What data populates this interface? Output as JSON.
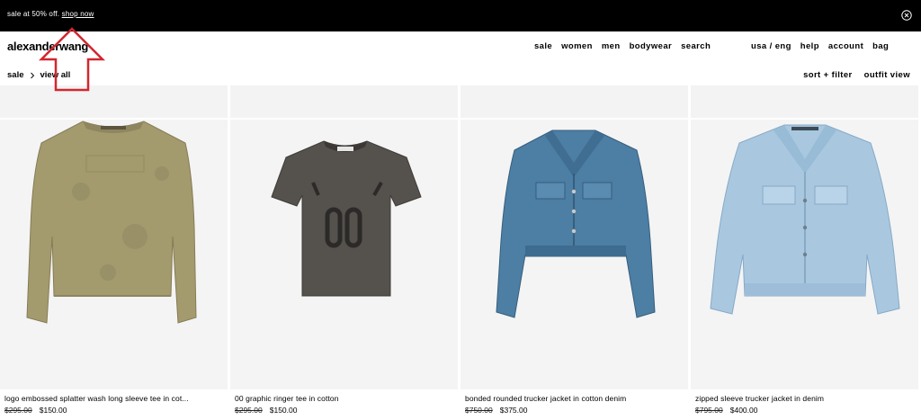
{
  "promo": {
    "text": "sale at 50% off.",
    "link": "shop now"
  },
  "logo": "alexanderwang",
  "nav": [
    "sale",
    "women",
    "men",
    "bodywear",
    "search"
  ],
  "utility": [
    "usa / eng",
    "help",
    "account",
    "bag"
  ],
  "breadcrumb": {
    "parent": "sale",
    "current": "view all"
  },
  "tools": {
    "sort_filter": "sort + filter",
    "outfit_view": "outfit view"
  },
  "products": [
    {
      "name": "logo embossed splatter wash long sleeve tee in cot...",
      "old_price": "$295.00",
      "price": "$150.00"
    },
    {
      "name": "00 graphic ringer tee in cotton",
      "old_price": "$295.00",
      "price": "$150.00"
    },
    {
      "name": "bonded rounded trucker jacket in cotton denim",
      "old_price": "$750.00",
      "price": "$375.00"
    },
    {
      "name": "zipped sleeve trucker jacket in denim",
      "old_price": "$795.00",
      "price": "$400.00"
    }
  ],
  "colors": {
    "promo_bg": "#000000",
    "tile_bg": "#f4f4f4",
    "annotation": "#d22630"
  },
  "icons": [
    "close-icon",
    "chevron-right-icon",
    "up-arrow-annotation-icon"
  ]
}
